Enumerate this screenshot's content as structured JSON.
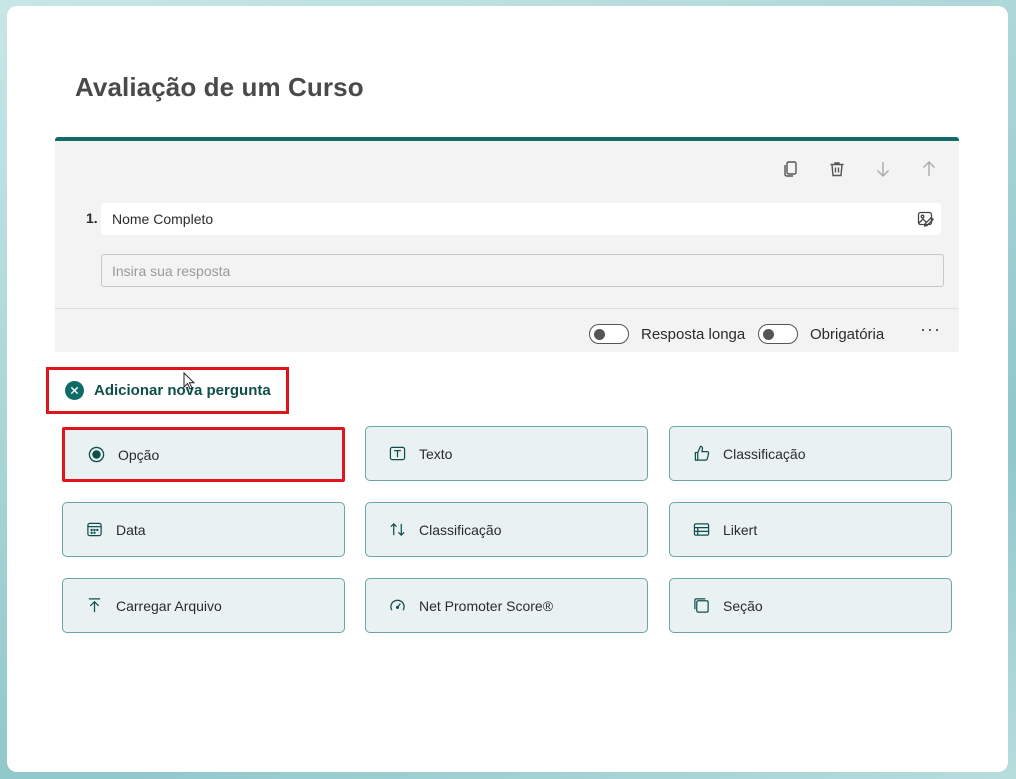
{
  "form": {
    "title": "Avaliação de um Curso"
  },
  "question": {
    "number": "1.",
    "title": "Nome Completo",
    "answer_placeholder": "Insira sua resposta",
    "toolbar": [
      "copy-icon",
      "delete-icon",
      "move-down-icon",
      "move-up-icon"
    ],
    "toggle_long_answer_label": "Resposta longa",
    "toggle_required_label": "Obrigatória",
    "toggle_long_answer_on": false,
    "toggle_required_on": false,
    "more_label": "···"
  },
  "add_question": {
    "label": "Adicionar nova pergunta"
  },
  "question_types": [
    {
      "label": "Opção",
      "icon": "radio-icon",
      "highlighted": true
    },
    {
      "label": "Texto",
      "icon": "text-icon"
    },
    {
      "label": "Classificação",
      "icon": "thumb-icon"
    },
    {
      "label": "Data",
      "icon": "calendar-icon"
    },
    {
      "label": "Classificação",
      "icon": "sort-icon"
    },
    {
      "label": "Likert",
      "icon": "likert-icon"
    },
    {
      "label": "Carregar Arquivo",
      "icon": "upload-icon"
    },
    {
      "label": "Net Promoter Score®",
      "icon": "gauge-icon"
    },
    {
      "label": "Seção",
      "icon": "section-icon"
    }
  ],
  "colors": {
    "accent": "#0f6b66",
    "highlight": "#e0151b",
    "option_bg": "#e9f1f3",
    "option_border": "#6aa6a4"
  }
}
